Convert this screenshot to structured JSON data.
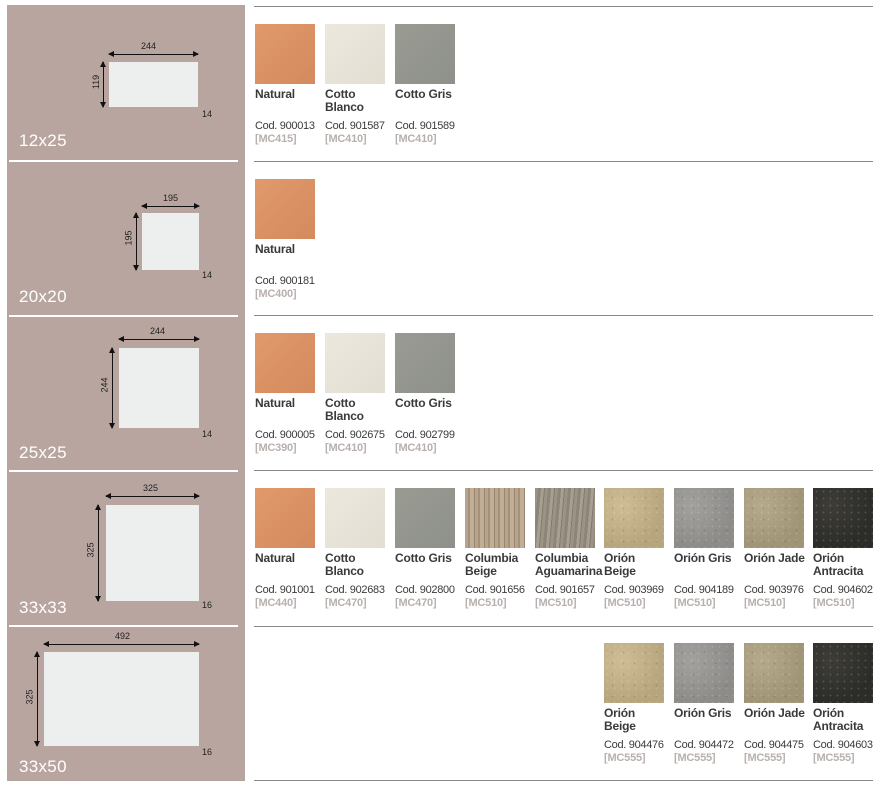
{
  "sections": [
    {
      "size": "12x25",
      "width_mm": "244",
      "height_mm": "119",
      "thickness": "14",
      "items": [
        {
          "name": "Natural",
          "code": "Cod. 900013",
          "ref": "[MC415]",
          "color": "#dd9569"
        },
        {
          "name": "Cotto Blanco",
          "code": "Cod. 901587",
          "ref": "[MC410]",
          "color": "#e9e5da"
        },
        {
          "name": "Cotto Gris",
          "code": "Cod. 901589",
          "ref": "[MC410]",
          "color": "#969890"
        }
      ]
    },
    {
      "size": "20x20",
      "width_mm": "195",
      "height_mm": "195",
      "thickness": "14",
      "items": [
        {
          "name": "Natural",
          "code": "Cod. 900181",
          "ref": "[MC400]",
          "color": "#dd9569"
        }
      ]
    },
    {
      "size": "25x25",
      "width_mm": "244",
      "height_mm": "244",
      "thickness": "14",
      "items": [
        {
          "name": "Natural",
          "code": "Cod. 900005",
          "ref": "[MC390]",
          "color": "#dd9569"
        },
        {
          "name": "Cotto Blanco",
          "code": "Cod. 902675",
          "ref": "[MC410]",
          "color": "#e9e5da"
        },
        {
          "name": "Cotto Gris",
          "code": "Cod. 902799",
          "ref": "[MC410]",
          "color": "#969890"
        }
      ]
    },
    {
      "size": "33x33",
      "width_mm": "325",
      "height_mm": "325",
      "thickness": "16",
      "items": [
        {
          "name": "Natural",
          "code": "Cod. 901001",
          "ref": "[MC440]",
          "color": "#dd9569"
        },
        {
          "name": "Cotto Blanco",
          "code": "Cod. 902683",
          "ref": "[MC470]",
          "color": "#e9e5da"
        },
        {
          "name": "Cotto Gris",
          "code": "Cod. 902800",
          "ref": "[MC470]",
          "color": "#969890"
        },
        {
          "name": "Columbia Beige",
          "code": "Cod. 901656",
          "ref": "[MC510]",
          "color": "#b3a086"
        },
        {
          "name": "Columbia Aguamarina",
          "code": "Cod. 901657",
          "ref": "[MC510]",
          "color": "#958e81"
        },
        {
          "name": "Orión Beige",
          "code": "Cod. 903969",
          "ref": "[MC510]",
          "color": "#c4b38a"
        },
        {
          "name": "Orión Gris",
          "code": "Cod. 904189",
          "ref": "[MC510]",
          "color": "#9a9895"
        },
        {
          "name": "Orión Jade",
          "code": "Cod. 903976",
          "ref": "[MC510]",
          "color": "#ab9f82"
        },
        {
          "name": "Orión Antracita",
          "code": "Cod. 904602",
          "ref": "[MC510]",
          "color": "#363531"
        }
      ]
    },
    {
      "size": "33x50",
      "width_mm": "492",
      "height_mm": "325",
      "thickness": "16",
      "items": [
        {
          "name": "Orión Beige",
          "code": "Cod. 904476",
          "ref": "[MC555]",
          "color": "#c4b38a"
        },
        {
          "name": "Orión Gris",
          "code": "Cod. 904472",
          "ref": "[MC555]",
          "color": "#9a9895"
        },
        {
          "name": "Orión Jade",
          "code": "Cod. 904475",
          "ref": "[MC555]",
          "color": "#ab9f82"
        },
        {
          "name": "Orión Antracita",
          "code": "Cod. 904603",
          "ref": "[MC555]",
          "color": "#363531"
        }
      ]
    }
  ]
}
